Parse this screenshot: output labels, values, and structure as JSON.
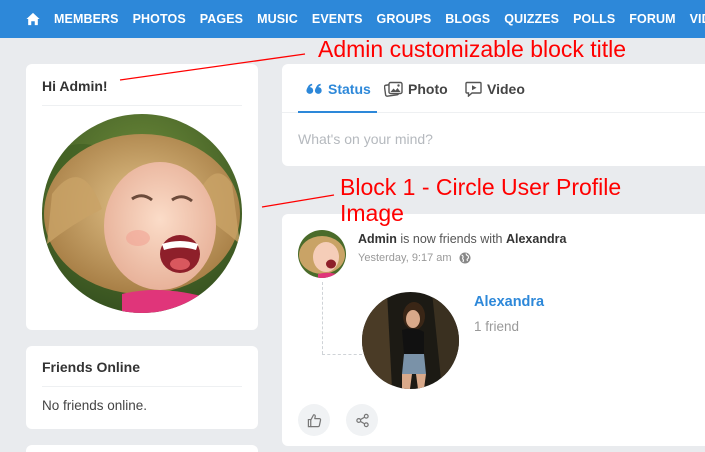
{
  "nav": {
    "items": [
      "MEMBERS",
      "PHOTOS",
      "PAGES",
      "MUSIC",
      "EVENTS",
      "GROUPS",
      "BLOGS",
      "QUIZZES",
      "POLLS",
      "FORUM",
      "VIDEOS"
    ]
  },
  "profile_block": {
    "title": "Hi Admin!"
  },
  "friends_block": {
    "title": "Friends Online",
    "empty_text": "No friends online."
  },
  "composer": {
    "tabs": [
      {
        "label": "Status",
        "icon": "quote-icon"
      },
      {
        "label": "Photo",
        "icon": "photo-icon"
      },
      {
        "label": "Video",
        "icon": "video-icon"
      }
    ],
    "active_tab": "Status",
    "placeholder": "What's on your mind?"
  },
  "feed": {
    "actor": "Admin",
    "action": "is now friends with",
    "target": "Alexandra",
    "timestamp": "Yesterday, 9:17 am",
    "privacy_icon": "globe-icon",
    "friend_card": {
      "name": "Alexandra",
      "friend_count": "1 friend"
    }
  },
  "annotations": {
    "title_note": "Admin customizable block title",
    "block1_note": "Block 1 - Circle User Profile Image"
  },
  "colors": {
    "accent": "#2d88d9",
    "annotation": "#ff0000",
    "background": "#e9ebee"
  }
}
